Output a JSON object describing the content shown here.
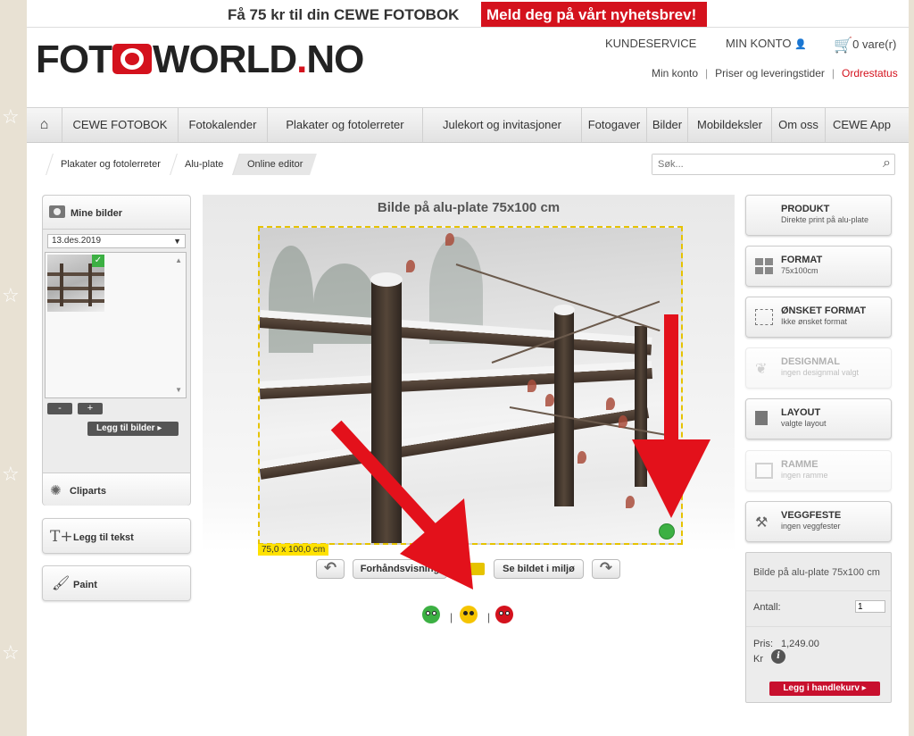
{
  "promo": {
    "text": "Få 75 kr til din CEWE FOTOBOK",
    "button": "Meld deg på vårt nyhetsbrev!"
  },
  "header": {
    "logo_a": "FOT",
    "logo_b": "WORLD",
    "logo_dot": ".",
    "logo_c": "NO",
    "customer_service": "KUNDESERVICE",
    "my_account": "MIN KONTO",
    "cart": "0 vare(r)",
    "sublinks": [
      "Min konto",
      "Priser og leveringstider",
      "Ordrestatus"
    ]
  },
  "nav": {
    "home_icon": "⌂",
    "items": [
      "CEWE FOTOBOK",
      "Fotokalender",
      "Plakater og fotolerreter",
      "Julekort og invitasjoner",
      "Fotogaver",
      "Bilder",
      "Mobildeksler",
      "Om oss",
      "CEWE App"
    ]
  },
  "breadcrumb": [
    "Plakater og fotolerreter",
    "Alu-plate",
    "Online editor"
  ],
  "search": {
    "placeholder": "Søk..."
  },
  "left": {
    "my_images": "Mine bilder",
    "date": "13.des.2019",
    "minus": "-",
    "plus": "+",
    "add_images": "Legg til bilder ▸",
    "cliparts": "Cliparts",
    "add_text_icon": "T+",
    "add_text": "Legg til tekst",
    "paint": "Paint"
  },
  "editor": {
    "title": "Bilde på alu-plate 75x100 cm",
    "size_tag": "75,0 x 100,0 cm",
    "preview": "Forhåndsvisning",
    "environment": "Se bildet i miljø",
    "undo_icon": "↶",
    "redo_icon": "↷"
  },
  "options": [
    {
      "title": "PRODUKT",
      "sub": "Direkte print på alu-plate",
      "icon": "none",
      "disabled": false
    },
    {
      "title": "FORMAT",
      "sub": "75x100cm",
      "icon": "grid-icon",
      "disabled": false
    },
    {
      "title": "ØNSKET FORMAT",
      "sub": "Ikke ønsket format",
      "icon": "crop-icon",
      "disabled": false
    },
    {
      "title": "DESIGNMAL",
      "sub": "ingen designmal valgt",
      "icon": "butterfly-icon",
      "disabled": true
    },
    {
      "title": "LAYOUT",
      "sub": "valgte layout",
      "icon": "layout-icon",
      "disabled": false
    },
    {
      "title": "RAMME",
      "sub": "ingen ramme",
      "icon": "frame-icon",
      "disabled": true
    },
    {
      "title": "VEGGFESTE",
      "sub": "ingen veggfester",
      "icon": "hammer-icon",
      "disabled": false
    }
  ],
  "order": {
    "title": "Bilde på alu-plate 75x100 cm",
    "qty_label": "Antall:",
    "qty_value": "1",
    "price_label": "Pris:",
    "price_value": "1,249.00",
    "currency": "Kr",
    "info_icon": "i",
    "add_to_cart": "Legg i handlekurv ▸"
  },
  "colors": {
    "brand_red": "#d4121d",
    "format_frame": "#e6c300",
    "good": "#3cb043",
    "ok": "#f5c400",
    "bad": "#d4121d"
  }
}
